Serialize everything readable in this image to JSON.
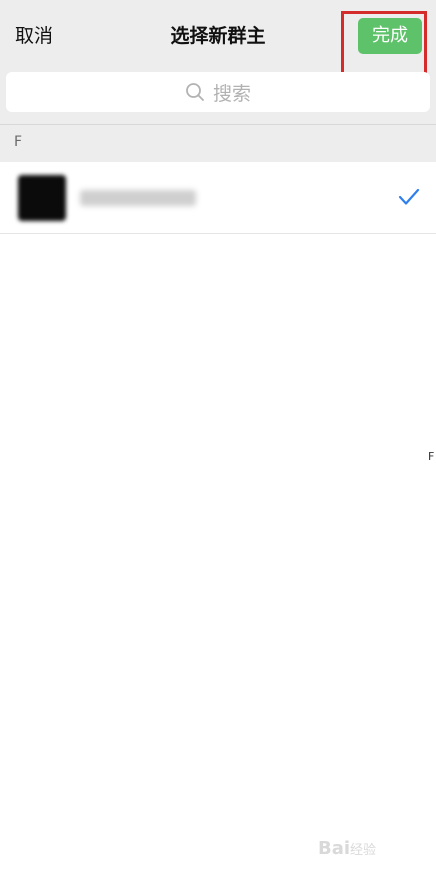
{
  "nav": {
    "cancel_label": "取消",
    "title": "选择新群主",
    "done_label": "完成"
  },
  "search": {
    "placeholder": "搜索",
    "icon": "search-icon"
  },
  "list": {
    "sections": [
      {
        "letter": "F",
        "items": [
          {
            "avatar": "blurred",
            "name": "blurred",
            "selected": true
          }
        ]
      }
    ]
  },
  "index_bar": {
    "letters": [
      "F"
    ]
  },
  "watermark": {
    "text": "Bai",
    "suffix": "经验"
  },
  "colors": {
    "accent": "#5ec26a",
    "highlight": "#d42b2b",
    "check": "#2f80ed",
    "background": "#ededed"
  }
}
